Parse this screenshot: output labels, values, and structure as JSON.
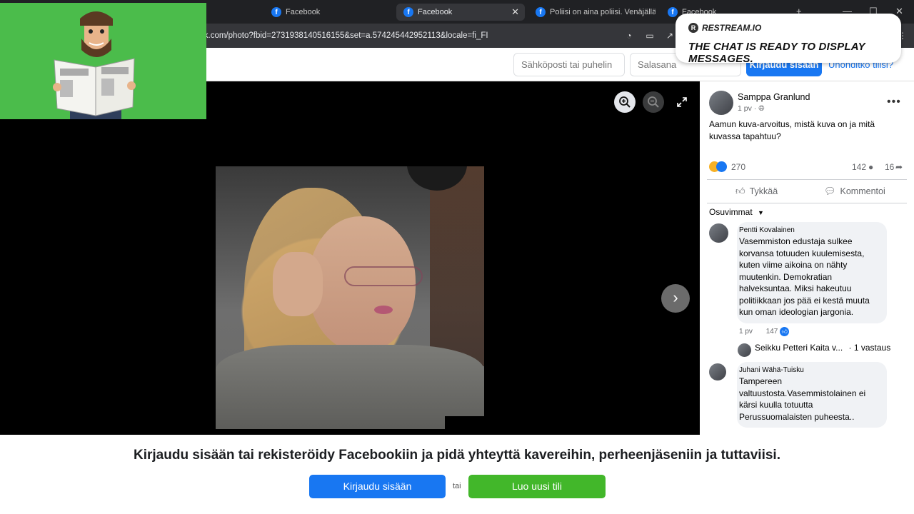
{
  "browser": {
    "tabs": [
      {
        "label": "Facebook",
        "active": false
      },
      {
        "label": "Facebook",
        "active": true
      },
      {
        "label": "Poliisi on aina poliisi. Venäjällä h",
        "active": false
      },
      {
        "label": "Facebook",
        "active": false
      }
    ],
    "url": "ck.com/photo?fbid=2731938140516155&set=a.574245442952113&locale=fi_FI"
  },
  "fb_header": {
    "email_placeholder": "Sähköposti tai puhelin",
    "password_placeholder": "Salasana",
    "login_label": "Kirjaudu sisään",
    "forgot_label": "Unohditko tilisi?"
  },
  "post": {
    "author": "Samppa Granlund",
    "meta": "1 pv ·",
    "text": "Aamun kuva-arvoitus, mistä kuva on ja mitä kuvassa tapahtuu?",
    "reaction_count": "270",
    "comment_count": "142",
    "share_count": "16",
    "like_label": "Tykkää",
    "comment_label": "Kommentoi",
    "sort_label": "Osuvimmat"
  },
  "comments": [
    {
      "name": "Pentti Kovalainen",
      "text": "Vasemmiston edustaja sulkee korvansa totuuden kuulemisesta, kuten viime aikoina on nähty muutenkin. Demokratian halveksuntaa. Miksi hakeutuu politiikkaan jos pää ei kestä muuta kun oman ideologian jargonia.",
      "time": "1 pv",
      "likes": "147"
    },
    {
      "name": "Juhani Wähä-Tuisku",
      "text": "Tampereen valtuustosta.Vasemmistolainen ei kärsi kuulla totuutta Perussuomalaisten puheesta..",
      "time": "",
      "likes": ""
    }
  ],
  "reply_preview": {
    "name": "Seikku Petteri Kaita v...",
    "count": "· 1 vastaus"
  },
  "bottom_bar": {
    "headline": "Kirjaudu sisään tai rekisteröidy Facebookiin ja pidä yhteyttä kavereihin, perheenjäseniin ja tuttaviisi.",
    "login_label": "Kirjaudu sisään",
    "or_label": "tai",
    "signup_label": "Luo uusi tili"
  },
  "overlay": {
    "brand": "RESTREAM.IO",
    "message": "THE CHAT IS READY TO DISPLAY MESSAGES."
  },
  "colors": {
    "fb_blue": "#1877f2",
    "signup_green": "#42b72a",
    "chrome_dark": "#202124",
    "cam_green": "#4bbc4b"
  }
}
